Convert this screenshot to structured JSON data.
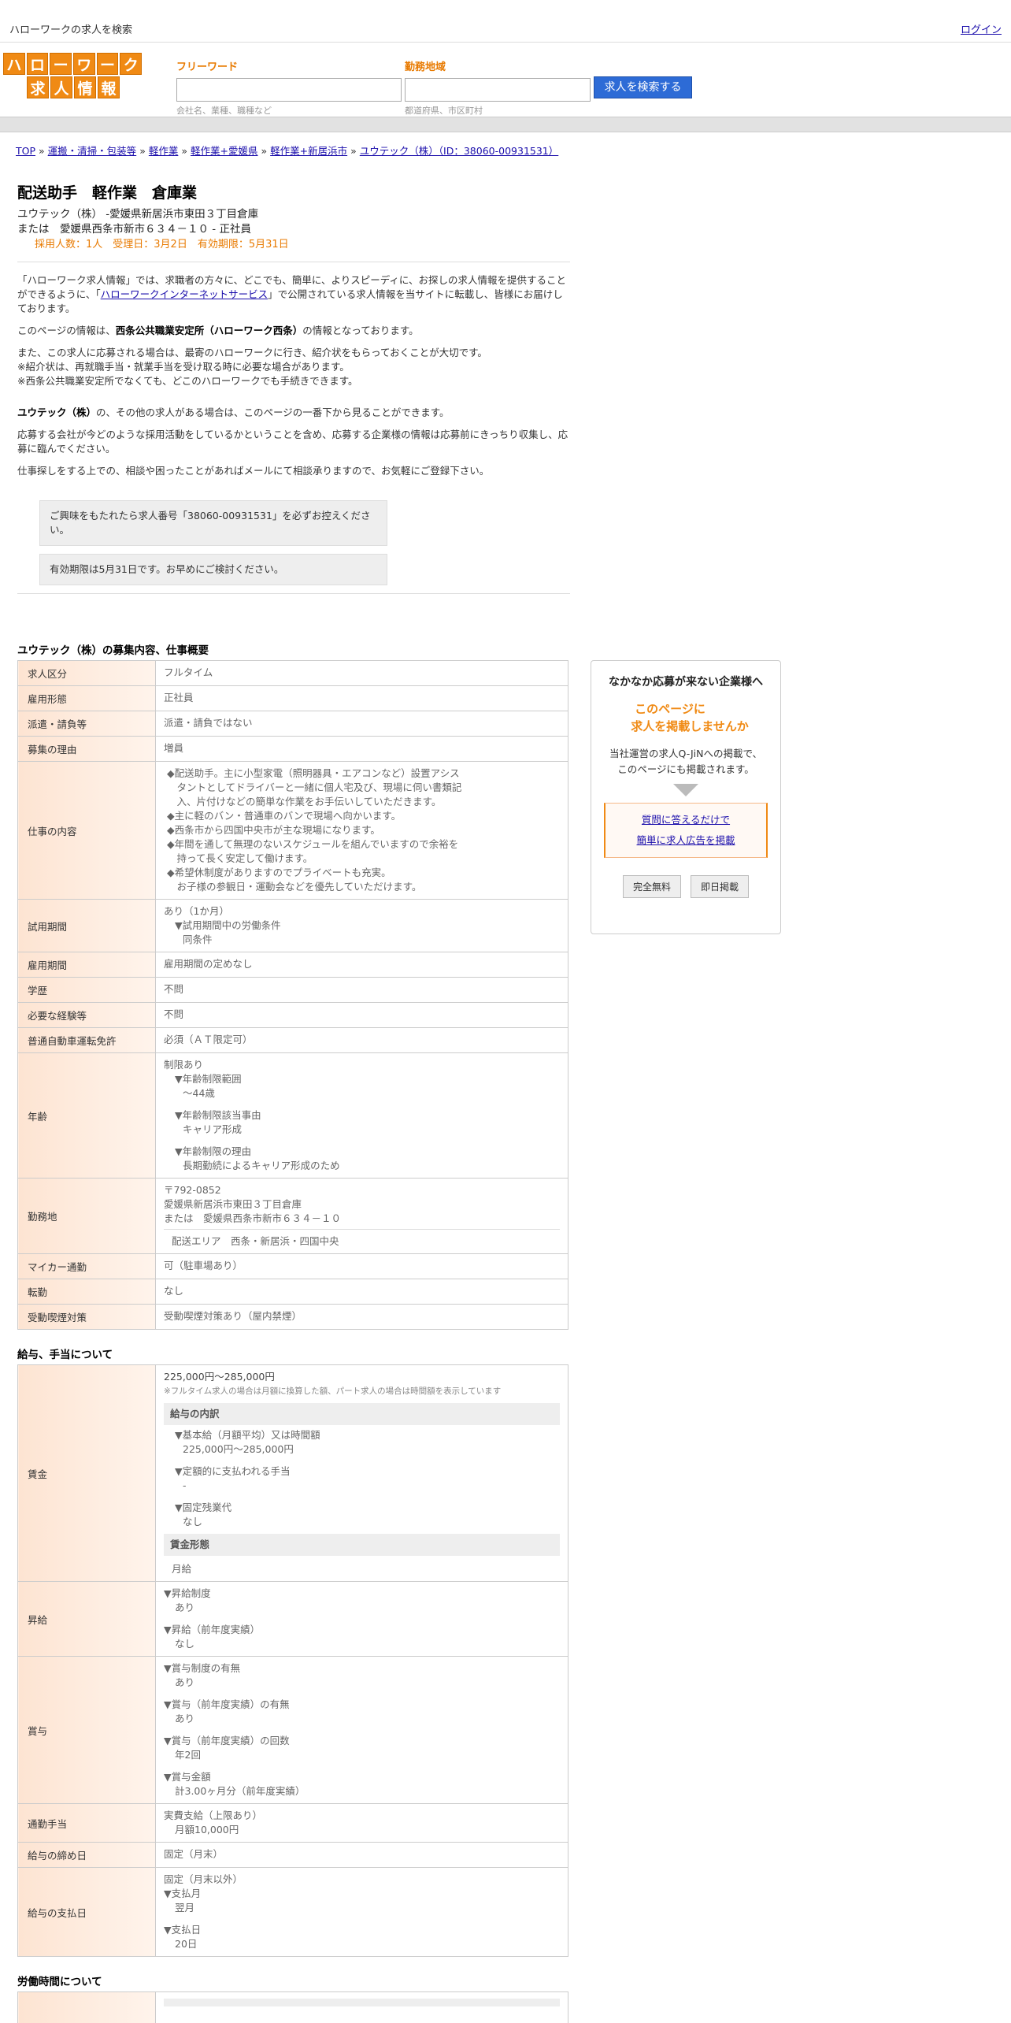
{
  "topbar": {
    "site_desc": "ハローワークの求人を検索",
    "login": "ログイン"
  },
  "logo": {
    "row1": [
      "ハ",
      "ロ",
      "ー",
      "ワ",
      "ー",
      "ク"
    ],
    "row2": [
      "求",
      "人",
      "情",
      "報"
    ]
  },
  "search": {
    "keyword_label": "フリーワード",
    "keyword_hint": "会社名、業種、職種など",
    "area_label": "勤務地域",
    "area_hint": "都道府県、市区町村",
    "button": "求人を検索する"
  },
  "breadcrumb": [
    "TOP",
    "運搬・清掃・包装等",
    "軽作業",
    "軽作業+愛媛県",
    "軽作業+新居浜市",
    "ユウテック（株）（ID：38060-00931531）"
  ],
  "breadcrumb_sep": "»",
  "job": {
    "title": "配送助手　軽作業　倉庫業",
    "company_line": "ユウテック（株） -愛媛県新居浜市東田３丁目倉庫",
    "alt_line": "または　愛媛県西条市新市６３４－１０ - 正社員",
    "meta": "採用人数：1人　受理日：3月2日　有効期限：5月31日"
  },
  "intro": {
    "p1_before": "「ハローワーク求人情報」では、求職者の方々に、どこでも、簡単に、よりスピーディに、お探しの求人情報を提供することができるように、「",
    "p1_link": "ハローワークインターネットサービス",
    "p1_after": "」で公開されている求人情報を当サイトに転載し、皆様にお届けしております。",
    "p2_before": "このページの情報は、",
    "p2_bold": "西条公共職業安定所（ハローワーク西条）",
    "p2_after": "の情報となっております。",
    "p3_1": "また、この求人に応募される場合は、最寄のハローワークに行き、紹介状をもらっておくことが大切です。",
    "p3_2": "※紹介状は、再就職手当・就業手当を受け取る時に必要な場合があります。",
    "p3_3": "※西条公共職業安定所でなくても、どこのハローワークでも手続きできます。",
    "p4_bold": "ユウテック（株）",
    "p4_after": "の、その他の求人がある場合は、このページの一番下から見ることができます。",
    "p5": "応募する会社が今どのような採用活動をしているかということを含め、応募する企業様の情報は応募前にきっちり収集し、応募に臨んでください。",
    "p6": "仕事探しをする上での、相談や困ったことがあればメールにて相談承りますので、お気軽にご登録下さい。",
    "box1": "ご興味をもたれたら求人番号「38060-00931531」を必ずお控えください。",
    "box2": "有効期限は5月31日です。お早めにご検討ください。"
  },
  "overview": {
    "title": "ユウテック（株）の募集内容、仕事概要",
    "rows": {
      "kubun": {
        "label": "求人区分",
        "value": "フルタイム"
      },
      "koyo": {
        "label": "雇用形態",
        "value": "正社員"
      },
      "haken": {
        "label": "派遣・請負等",
        "value": "派遣・請負ではない"
      },
      "riyu": {
        "label": "募集の理由",
        "value": "増員"
      },
      "naiyo": {
        "label": "仕事の内容",
        "lines": [
          "◆配送助手。主に小型家電（照明器具・エアコンなど）設置アシス",
          "　タントとしてドライバーと一緒に個人宅及び、現場に伺い書類記",
          "　入、片付けなどの簡単な作業をお手伝いしていただきます。",
          "◆主に軽のバン・普通車のバンで現場へ向かいます。",
          "◆西条市から四国中央市が主な現場になります。",
          "◆年間を通して無理のないスケジュールを組んでいますので余裕を",
          "　持って長く安定して働けます。",
          "◆希望休制度がありますのでプライベートも充実。",
          "　お子様の参観日・運動会などを優先していただけます。"
        ]
      },
      "shiyo": {
        "label": "試用期間",
        "v1": "あり（1か月）",
        "v2": "▼試用期間中の労働条件",
        "v3": "同条件"
      },
      "kikan": {
        "label": "雇用期間",
        "value": "雇用期間の定めなし"
      },
      "gakureki": {
        "label": "学歴",
        "value": "不問"
      },
      "keiken": {
        "label": "必要な経験等",
        "value": "不問"
      },
      "menkyo": {
        "label": "普通自動車運転免許",
        "value": "必須（ＡＴ限定可）"
      },
      "nenrei": {
        "label": "年齢",
        "v1": "制限あり",
        "v2": "▼年齢制限範囲",
        "v3": "〜44歳",
        "v4": "▼年齢制限該当事由",
        "v5": "キャリア形成",
        "v6": "▼年齢制限の理由",
        "v7": "長期勤続によるキャリア形成のため"
      },
      "kinmuchi": {
        "label": "勤務地",
        "v1": "〒792-0852",
        "v2": "愛媛県新居浜市東田３丁目倉庫",
        "v3": "または　愛媛県西条市新市６３４－１０",
        "v4": "配送エリア　西条・新居浜・四国中央"
      },
      "mycar": {
        "label": "マイカー通勤",
        "value": "可（駐車場あり）"
      },
      "tenkin": {
        "label": "転勤",
        "value": "なし"
      },
      "judo": {
        "label": "受動喫煙対策",
        "value": "受動喫煙対策あり（屋内禁煙）"
      }
    }
  },
  "salary": {
    "title": "給与、手当について",
    "chingin": {
      "label": "賃金",
      "range": "225,000円〜285,000円",
      "note": "※フルタイム求人の場合は月額に換算した額、パート求人の場合は時間額を表示しています",
      "uchiwake": "給与の内訳",
      "k1": "▼基本給（月額平均）又は時間額",
      "k1v": "225,000円〜285,000円",
      "k2": "▼定額的に支払われる手当",
      "k2v": "-",
      "k3": "▼固定残業代",
      "k3v": "なし",
      "keitai": "賃金形態",
      "keitai_v": "月給"
    },
    "shokyu": {
      "label": "昇給",
      "s1": "▼昇給制度",
      "s1v": "あり",
      "s2": "▼昇給（前年度実績）",
      "s2v": "なし"
    },
    "shoyo": {
      "label": "賞与",
      "b1": "▼賞与制度の有無",
      "b1v": "あり",
      "b2": "▼賞与（前年度実績）の有無",
      "b2v": "あり",
      "b3": "▼賞与（前年度実績）の回数",
      "b3v": "年2回",
      "b4": "▼賞与金額",
      "b4v": "計3.00ヶ月分（前年度実績）"
    },
    "tsukin": {
      "label": "通勤手当",
      "v1": "実費支給（上限あり）",
      "v2": "月額10,000円"
    },
    "shime": {
      "label": "給与の締め日",
      "value": "固定（月末）"
    },
    "shiharai": {
      "label": "給与の支払日",
      "v1": "固定（月末以外）",
      "v2": "▼支払月",
      "v3": "翌月",
      "v4": "▼支払日",
      "v5": "20日"
    }
  },
  "worktime": {
    "title": "労働時間について"
  },
  "sidebox": {
    "title": "なかなか応募が来ない企業様へ",
    "catch1": "このページに",
    "catch2": "求人を掲載しませんか",
    "desc1": "当社運営の求人Q-JiNへの掲載で、",
    "desc2": "このページにも掲載されます。",
    "link1": "質問に答えるだけで",
    "link2": "簡単に求人広告を掲載",
    "tag1": "完全無料",
    "tag2": "即日掲載"
  }
}
